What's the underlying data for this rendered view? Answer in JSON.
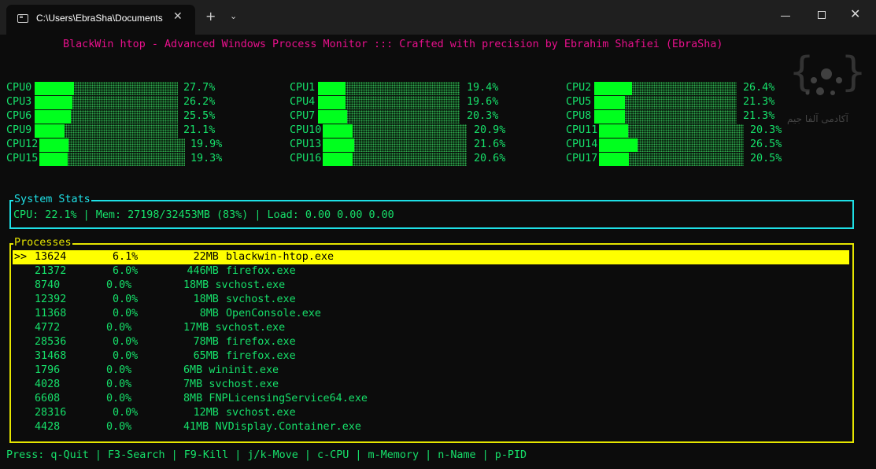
{
  "window": {
    "tab_title": "C:\\Users\\EbraSha\\Documents"
  },
  "header": "BlackWin htop - Advanced Windows Process Monitor ::: Crafted with precision by Ebrahim Shafiei (EbraSha)",
  "cpus": [
    {
      "label": "CPU0",
      "percent": 27.7,
      "text": "27.7%"
    },
    {
      "label": "CPU1",
      "percent": 19.4,
      "text": "19.4%"
    },
    {
      "label": "CPU2",
      "percent": 26.4,
      "text": "26.4%"
    },
    {
      "label": "CPU3",
      "percent": 26.2,
      "text": "26.2%"
    },
    {
      "label": "CPU4",
      "percent": 19.6,
      "text": "19.6%"
    },
    {
      "label": "CPU5",
      "percent": 21.3,
      "text": "21.3%"
    },
    {
      "label": "CPU6",
      "percent": 25.5,
      "text": "25.5%"
    },
    {
      "label": "CPU7",
      "percent": 20.3,
      "text": "20.3%"
    },
    {
      "label": "CPU8",
      "percent": 21.3,
      "text": "21.3%"
    },
    {
      "label": "CPU9",
      "percent": 21.1,
      "text": "21.1%"
    },
    {
      "label": "CPU10",
      "percent": 20.9,
      "text": "20.9%"
    },
    {
      "label": "CPU11",
      "percent": 20.3,
      "text": "20.3%"
    },
    {
      "label": "CPU12",
      "percent": 19.9,
      "text": "19.9%"
    },
    {
      "label": "CPU13",
      "percent": 21.6,
      "text": "21.6%"
    },
    {
      "label": "CPU14",
      "percent": 26.5,
      "text": "26.5%"
    },
    {
      "label": "CPU15",
      "percent": 19.3,
      "text": "19.3%"
    },
    {
      "label": "CPU16",
      "percent": 20.6,
      "text": "20.6%"
    },
    {
      "label": "CPU17",
      "percent": 20.5,
      "text": "20.5%"
    }
  ],
  "stats": {
    "title": "System Stats",
    "line": "CPU: 22.1% | Mem: 27198/32453MB (83%) | Load: 0.00 0.00 0.00"
  },
  "processes": {
    "title": "Processes",
    "cursor": ">>",
    "rows": [
      {
        "pid": "13624",
        "cpu": "6.1%",
        "mem": "22MB",
        "name": "blackwin-htop.exe"
      },
      {
        "pid": "21372",
        "cpu": "6.0%",
        "mem": "446MB",
        "name": "firefox.exe"
      },
      {
        "pid": "8740",
        "cpu": "0.0%",
        "mem": "18MB",
        "name": "svchost.exe"
      },
      {
        "pid": "12392",
        "cpu": "0.0%",
        "mem": "18MB",
        "name": "svchost.exe"
      },
      {
        "pid": "11368",
        "cpu": "0.0%",
        "mem": "8MB",
        "name": "OpenConsole.exe"
      },
      {
        "pid": "4772",
        "cpu": "0.0%",
        "mem": "17MB",
        "name": "svchost.exe"
      },
      {
        "pid": "28536",
        "cpu": "0.0%",
        "mem": "78MB",
        "name": "firefox.exe"
      },
      {
        "pid": "31468",
        "cpu": "0.0%",
        "mem": "65MB",
        "name": "firefox.exe"
      },
      {
        "pid": "1796",
        "cpu": "0.0%",
        "mem": "6MB",
        "name": "wininit.exe"
      },
      {
        "pid": "4028",
        "cpu": "0.0%",
        "mem": "7MB",
        "name": "svchost.exe"
      },
      {
        "pid": "6608",
        "cpu": "0.0%",
        "mem": "8MB",
        "name": "FNPLicensingService64.exe"
      },
      {
        "pid": "28316",
        "cpu": "0.0%",
        "mem": "12MB",
        "name": "svchost.exe"
      },
      {
        "pid": "4428",
        "cpu": "0.0%",
        "mem": "41MB",
        "name": "NVDisplay.Container.exe"
      }
    ]
  },
  "footer": "Press: q-Quit | F3-Search | F9-Kill | j/k-Move | c-CPU | m-Memory | n-Name | p-PID",
  "colors": {
    "accent": "#16e06a",
    "header": "#e8108c",
    "stats_border": "#1ee0e6",
    "proc_border": "#e6e600",
    "bar_fill": "#00ff1e"
  },
  "watermark": {
    "icon": "academy-logo-icon",
    "text": "آکادمی آلفا جیم"
  }
}
